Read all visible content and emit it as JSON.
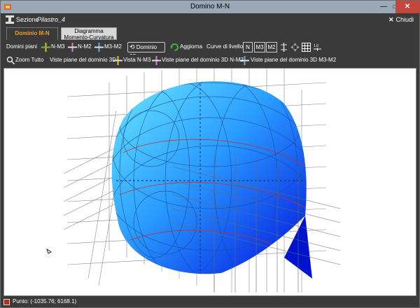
{
  "window": {
    "title": "Domino M-N",
    "minimize": "—",
    "maximize": "□",
    "close": "✕"
  },
  "section": {
    "label": "Sezione",
    "value": "Pilastro_4",
    "close_label": "Chiudi"
  },
  "tabs": [
    {
      "label": "Dominio M-N"
    },
    {
      "label": "Diagramma Momento-Curvatura"
    }
  ],
  "toolbar1": {
    "domini_piani": "Domini piani",
    "n_m3": "N-M3",
    "n_m2": "N-M2",
    "m3_m2": "M3-M2",
    "dominio_3d": "Dominio 3D",
    "aggiorna": "Aggiorna",
    "curve_livello": "Curve di livello",
    "lvl_n": "N",
    "lvl_m3": "M3",
    "lvl_m2": "M2"
  },
  "toolbar2": {
    "zoom_tutto": "Zoom Tutto",
    "viste_3d": "Viste piane del dominio 3D",
    "vista_n_m3": "Vista N-M3",
    "viste_n_m2": "Viste piane del dominio 3D N-M2",
    "viste_m3_m2": "Viste piane del dominio 3D M3-M2"
  },
  "status": {
    "label": "Punto: (-1035.76; 6168.1)"
  },
  "colors": {
    "surface_light": "#5ad0ff",
    "surface_dark": "#0018e0",
    "grid": "#8a8a8a",
    "accent_tab": "#f0a020"
  },
  "icons": [
    "app-icon",
    "section-i-beam-icon",
    "close-icon",
    "plane-icon",
    "refresh-icon",
    "zoom-icon",
    "grid-icon",
    "scale-icon",
    "cursor-icon"
  ]
}
